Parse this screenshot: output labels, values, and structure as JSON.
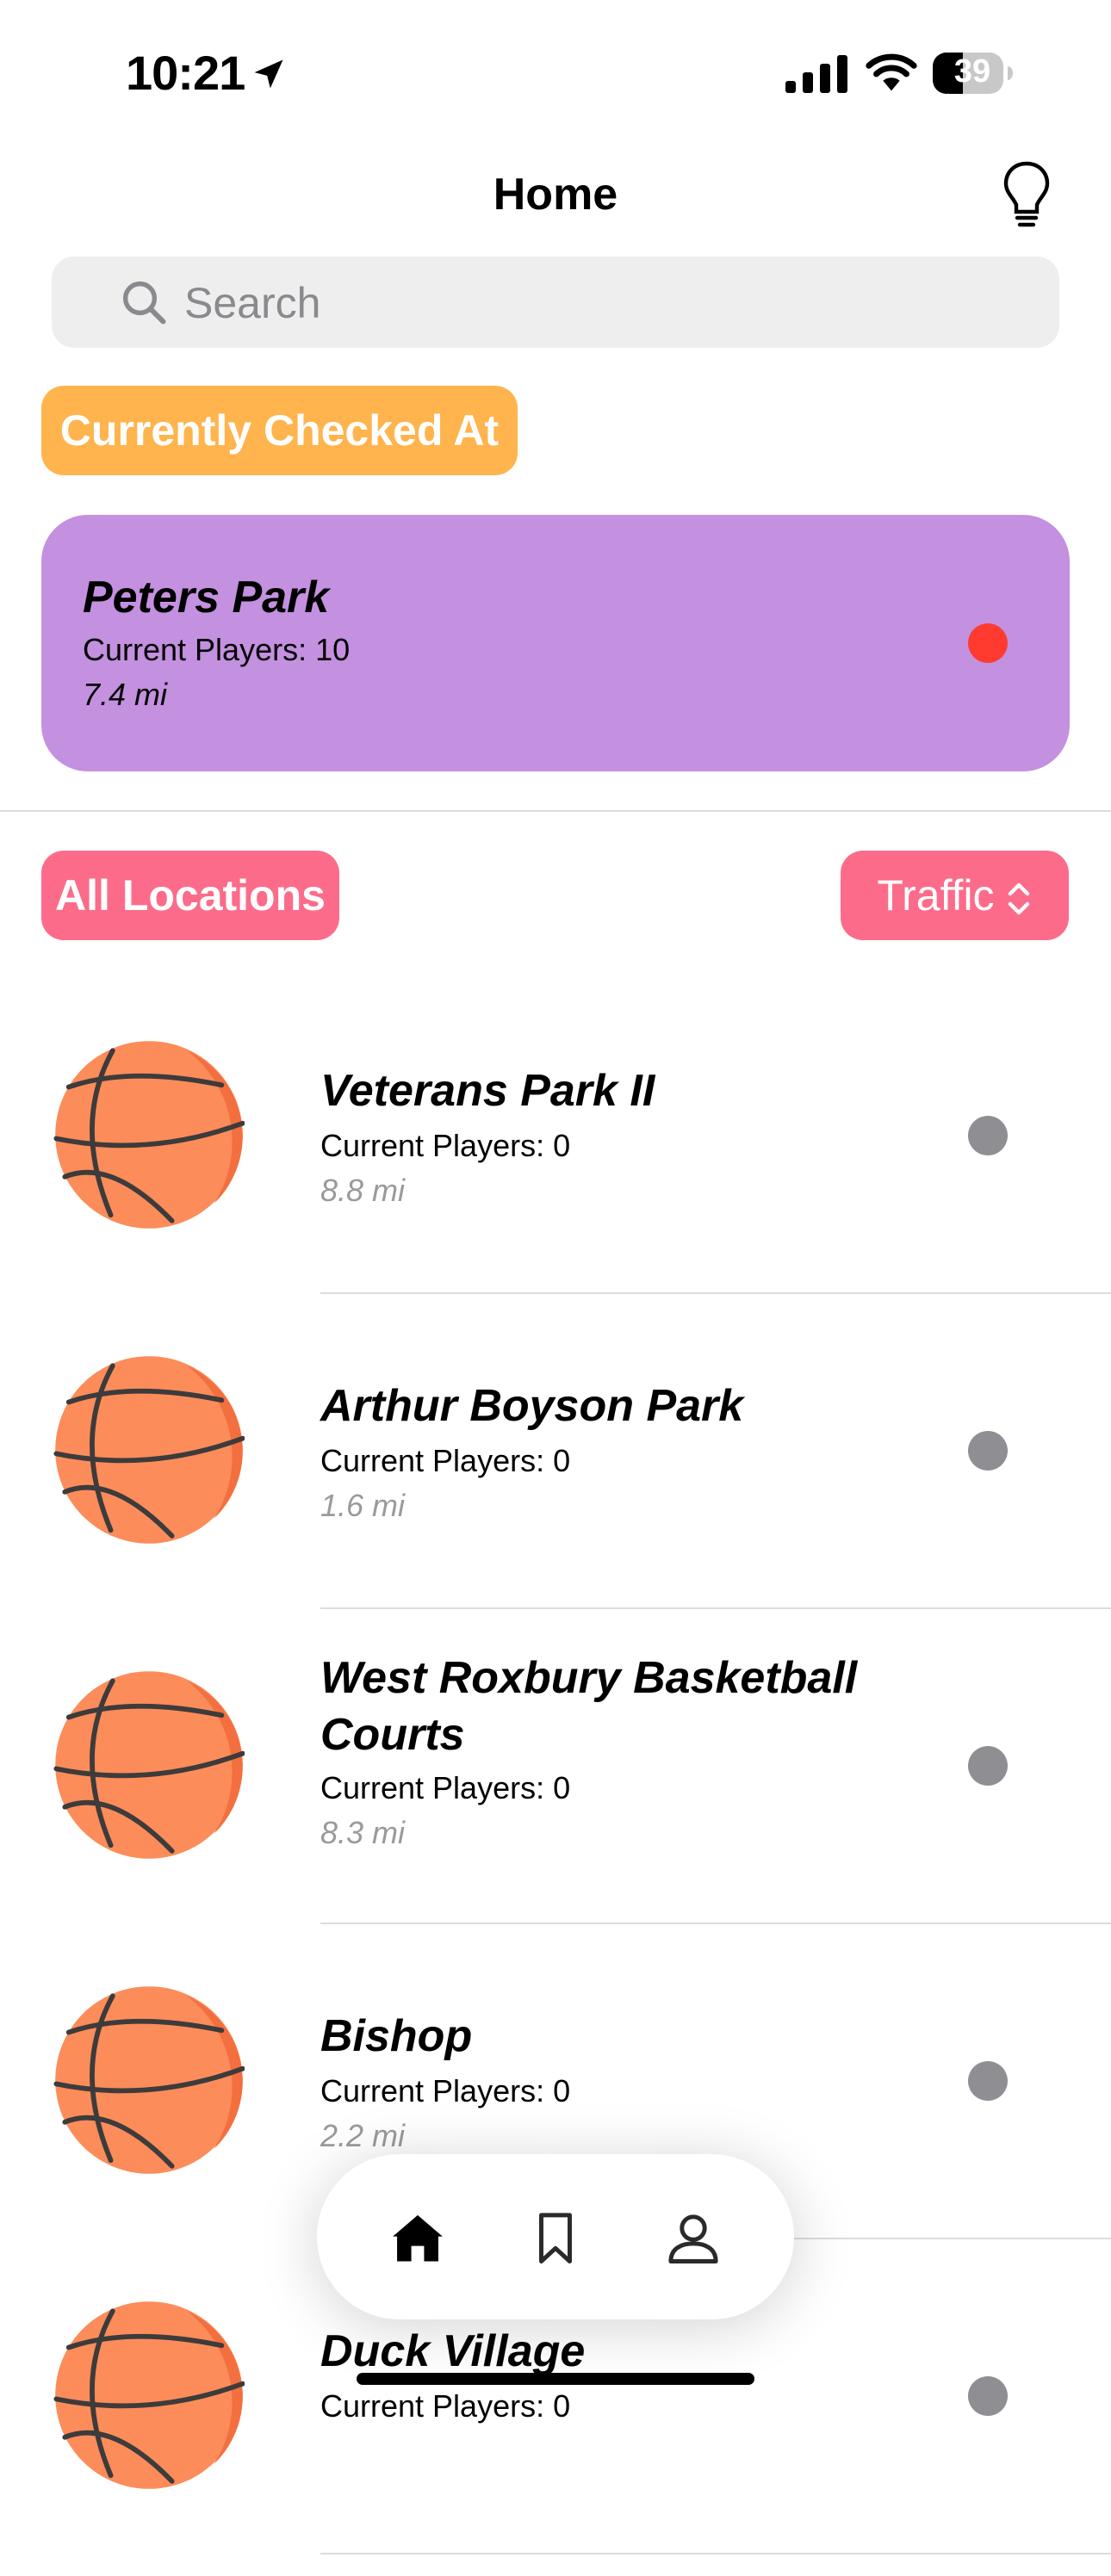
{
  "status_bar": {
    "time": "10:21",
    "battery": "39"
  },
  "header": {
    "title": "Home"
  },
  "search": {
    "placeholder": "Search"
  },
  "checked_in": {
    "label": "Currently Checked At",
    "name": "Peters Park",
    "players": "Current Players: 10",
    "distance": "7.4 mi",
    "status_color": "#ff3b30"
  },
  "locations": {
    "label": "All Locations",
    "sort_label": "Traffic",
    "items": [
      {
        "name": "Veterans Park II",
        "players": "Current Players: 0",
        "distance": "8.8 mi"
      },
      {
        "name": "Arthur Boyson Park",
        "players": "Current Players: 0",
        "distance": "1.6 mi"
      },
      {
        "name": "West Roxbury Basketball Courts",
        "players": "Current Players: 0",
        "distance": "8.3 mi"
      },
      {
        "name": "Bishop",
        "players": "Current Players: 0",
        "distance": "2.2 mi"
      },
      {
        "name": "Duck Village",
        "players": "Current Players: 0",
        "distance": ""
      }
    ]
  },
  "tabs": [
    {
      "icon": "home-icon",
      "active": true
    },
    {
      "icon": "bookmark-icon",
      "active": false
    },
    {
      "icon": "person-icon",
      "active": false
    }
  ],
  "colors": {
    "checked_card": "#c490e0",
    "orange_pill": "#ffb44d",
    "pink_pill": "#fc6c8a",
    "ball": "#fc8c5a",
    "inactive_dot": "#8e8e93"
  }
}
